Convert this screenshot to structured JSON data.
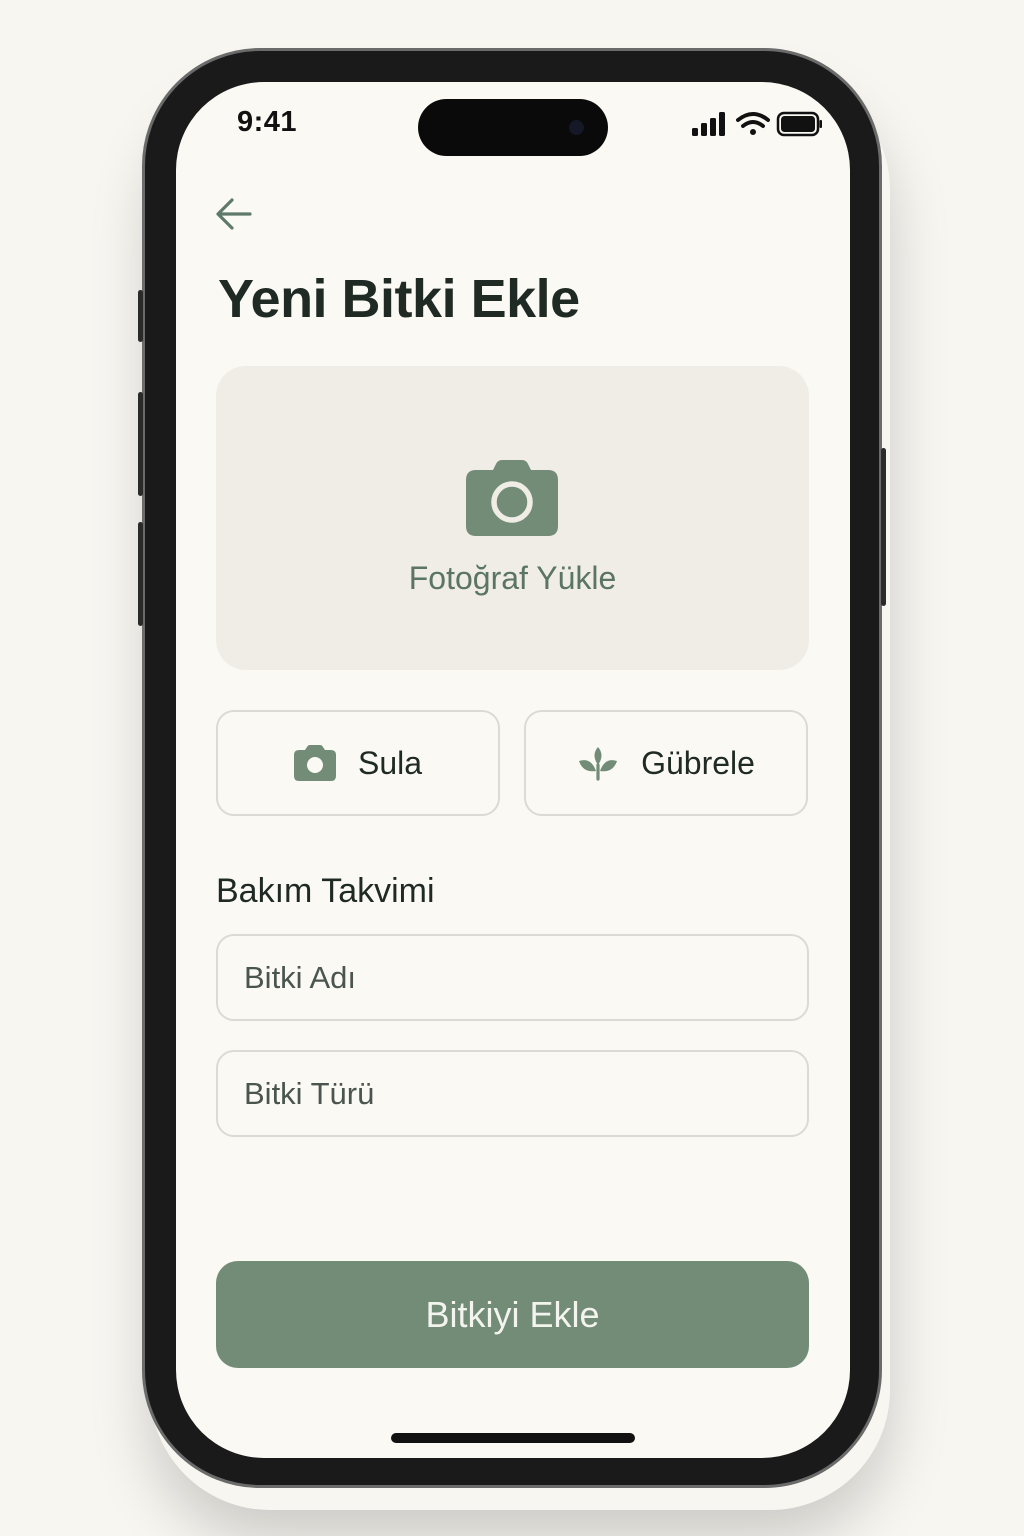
{
  "status_bar": {
    "time": "9:41",
    "icons": [
      "signal-icon",
      "wifi-icon",
      "battery-icon"
    ]
  },
  "header": {
    "back_icon": "arrow-left-icon",
    "title": "Yeni Bitki Ekle"
  },
  "photo_upload": {
    "icon": "camera-icon",
    "label": "Fotoğraf Yükle"
  },
  "actions": [
    {
      "icon": "camera-icon",
      "label": "Sula"
    },
    {
      "icon": "sprout-icon",
      "label": "Gübrele"
    }
  ],
  "care_schedule": {
    "title": "Bakım Takvimi",
    "fields": [
      {
        "placeholder": "Bitki Adı",
        "value": ""
      },
      {
        "placeholder": "Bitki Türü",
        "value": ""
      }
    ]
  },
  "submit": {
    "label": "Bitkiyi Ekle"
  },
  "colors": {
    "accent": "#728c78",
    "background": "#fbf9f4",
    "photo_box": "#efede6",
    "text": "#1f2a24"
  }
}
